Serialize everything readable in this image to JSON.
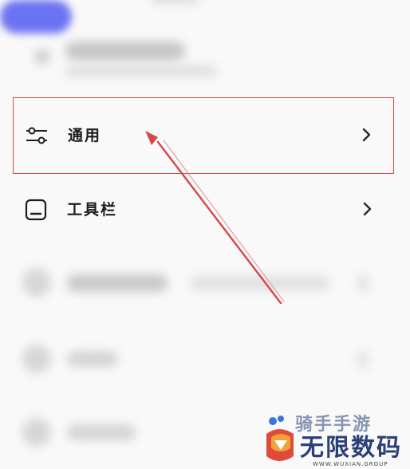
{
  "settings": {
    "items": [
      {
        "label": "通用",
        "icon": "sliders-icon",
        "highlighted": true
      },
      {
        "label": "工具栏",
        "icon": "toolbar-icon",
        "highlighted": false
      }
    ]
  },
  "annotation": {
    "color": "#d6484b"
  },
  "watermark": {
    "top_text": "骑手手游",
    "brand": "无限数码",
    "subtitle": "WWW.WUXIAN.GROUP"
  },
  "colors": {
    "blurred_button": "#6c73f2",
    "highlight_border": "#d6484b"
  }
}
